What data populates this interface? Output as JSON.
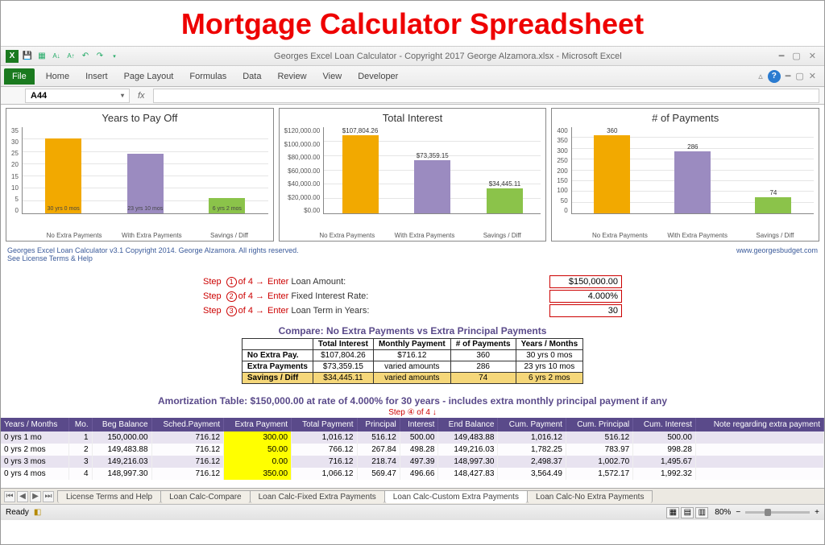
{
  "page_heading": "Mortgage Calculator Spreadsheet",
  "window_title": "Georges Excel Loan Calculator - Copyright 2017 George Alzamora.xlsx - Microsoft Excel",
  "ribbon_tabs": [
    "File",
    "Home",
    "Insert",
    "Page Layout",
    "Formulas",
    "Data",
    "Review",
    "View",
    "Developer"
  ],
  "namebox": "A44",
  "meta_left_1": "Georges Excel Loan Calculator v3.1   Copyright 2014. George Alzamora. All rights reserved.",
  "meta_left_2": "See License Terms & Help",
  "meta_right": "www.georgesbudget.com",
  "steps": {
    "s1": {
      "prefix": "Step",
      "num": "1",
      "of": " of 4 →",
      "enter": "Enter",
      "label": "Loan Amount:",
      "value": "$150,000.00"
    },
    "s2": {
      "prefix": "Step",
      "num": "2",
      "of": " of 4 →",
      "enter": "Enter",
      "label": "Fixed Interest Rate:",
      "value": "4.000%"
    },
    "s3": {
      "prefix": "Step",
      "num": "3",
      "of": " of 4 →",
      "enter": "Enter",
      "label": "Loan Term in Years:",
      "value": "30"
    }
  },
  "compare_title": "Compare: No Extra Payments vs Extra Principal Payments",
  "compare": {
    "headers": [
      "",
      "Total Interest",
      "Monthly Payment",
      "# of Payments",
      "Years / Months"
    ],
    "rows": [
      {
        "h": "No Extra Pay.",
        "c": [
          "$107,804.26",
          "$716.12",
          "360",
          "30 yrs 0 mos"
        ],
        "hl": false
      },
      {
        "h": "Extra Payments",
        "c": [
          "$73,359.15",
          "varied amounts",
          "286",
          "23 yrs 10 mos"
        ],
        "hl": false
      },
      {
        "h": "Savings / Diff",
        "c": [
          "$34,445.11",
          "varied amounts",
          "74",
          "6 yrs 2 mos"
        ],
        "hl": true
      }
    ]
  },
  "amort_title": "Amortization Table:  $150,000.00 at rate of 4.000% for 30 years - includes extra monthly principal payment if any",
  "step4_label": "Step ④ of 4 ↓",
  "amort_headers": [
    "Years / Months",
    "Mo.",
    "Beg Balance",
    "Sched.Payment",
    "Extra Payment",
    "Total Payment",
    "Principal",
    "Interest",
    "End Balance",
    "Cum. Payment",
    "Cum. Principal",
    "Cum. Interest",
    "Note regarding extra payment"
  ],
  "amort_rows": [
    [
      "0 yrs 1 mo",
      "1",
      "150,000.00",
      "716.12",
      "300.00",
      "1,016.12",
      "516.12",
      "500.00",
      "149,483.88",
      "1,016.12",
      "516.12",
      "500.00",
      ""
    ],
    [
      "0 yrs 2 mos",
      "2",
      "149,483.88",
      "716.12",
      "50.00",
      "766.12",
      "267.84",
      "498.28",
      "149,216.03",
      "1,782.25",
      "783.97",
      "998.28",
      ""
    ],
    [
      "0 yrs 3 mos",
      "3",
      "149,216.03",
      "716.12",
      "0.00",
      "716.12",
      "218.74",
      "497.39",
      "148,997.30",
      "2,498.37",
      "1,002.70",
      "1,495.67",
      ""
    ],
    [
      "0 yrs 4 mos",
      "4",
      "148,997.30",
      "716.12",
      "350.00",
      "1,066.12",
      "569.47",
      "496.66",
      "148,427.83",
      "3,564.49",
      "1,572.17",
      "1,992.32",
      ""
    ]
  ],
  "sheet_tabs": [
    "License Terms and Help",
    "Loan Calc-Compare",
    "Loan Calc-Fixed Extra Payments",
    "Loan Calc-Custom Extra Payments",
    "Loan Calc-No Extra Payments"
  ],
  "active_tab_index": 3,
  "status_ready": "Ready",
  "zoom_pct": "80%",
  "chart_data": [
    {
      "type": "bar",
      "title": "Years to Pay Off",
      "categories": [
        "No Extra Payments",
        "With Extra Payments",
        "Savings / Diff"
      ],
      "values": [
        30,
        23.83,
        6.17
      ],
      "bar_labels": [
        "",
        "",
        ""
      ],
      "inner_labels": [
        "30 yrs 0 mos",
        "23 yrs 10 mos",
        "6 yrs 2 mos"
      ],
      "ylim": [
        0,
        35
      ],
      "yticks": [
        "35",
        "30",
        "25",
        "20",
        "15",
        "10",
        "5",
        "0"
      ]
    },
    {
      "type": "bar",
      "title": "Total Interest",
      "categories": [
        "No Extra Payments",
        "With Extra Payments",
        "Savings / Diff"
      ],
      "values": [
        107804.26,
        73359.15,
        34445.11
      ],
      "bar_labels": [
        "$107,804.26",
        "$73,359.15",
        "$34,445.11"
      ],
      "inner_labels": [
        "",
        "",
        ""
      ],
      "ylim": [
        0,
        120000
      ],
      "yticks": [
        "$120,000.00",
        "$100,000.00",
        "$80,000.00",
        "$60,000.00",
        "$40,000.00",
        "$20,000.00",
        "$0.00"
      ]
    },
    {
      "type": "bar",
      "title": "# of Payments",
      "categories": [
        "No Extra Payments",
        "With Extra Payments",
        "Savings / Diff"
      ],
      "values": [
        360,
        286,
        74
      ],
      "bar_labels": [
        "360",
        "286",
        "74"
      ],
      "inner_labels": [
        "",
        "",
        ""
      ],
      "ylim": [
        0,
        400
      ],
      "yticks": [
        "400",
        "350",
        "300",
        "250",
        "200",
        "150",
        "100",
        "50",
        "0"
      ]
    }
  ]
}
